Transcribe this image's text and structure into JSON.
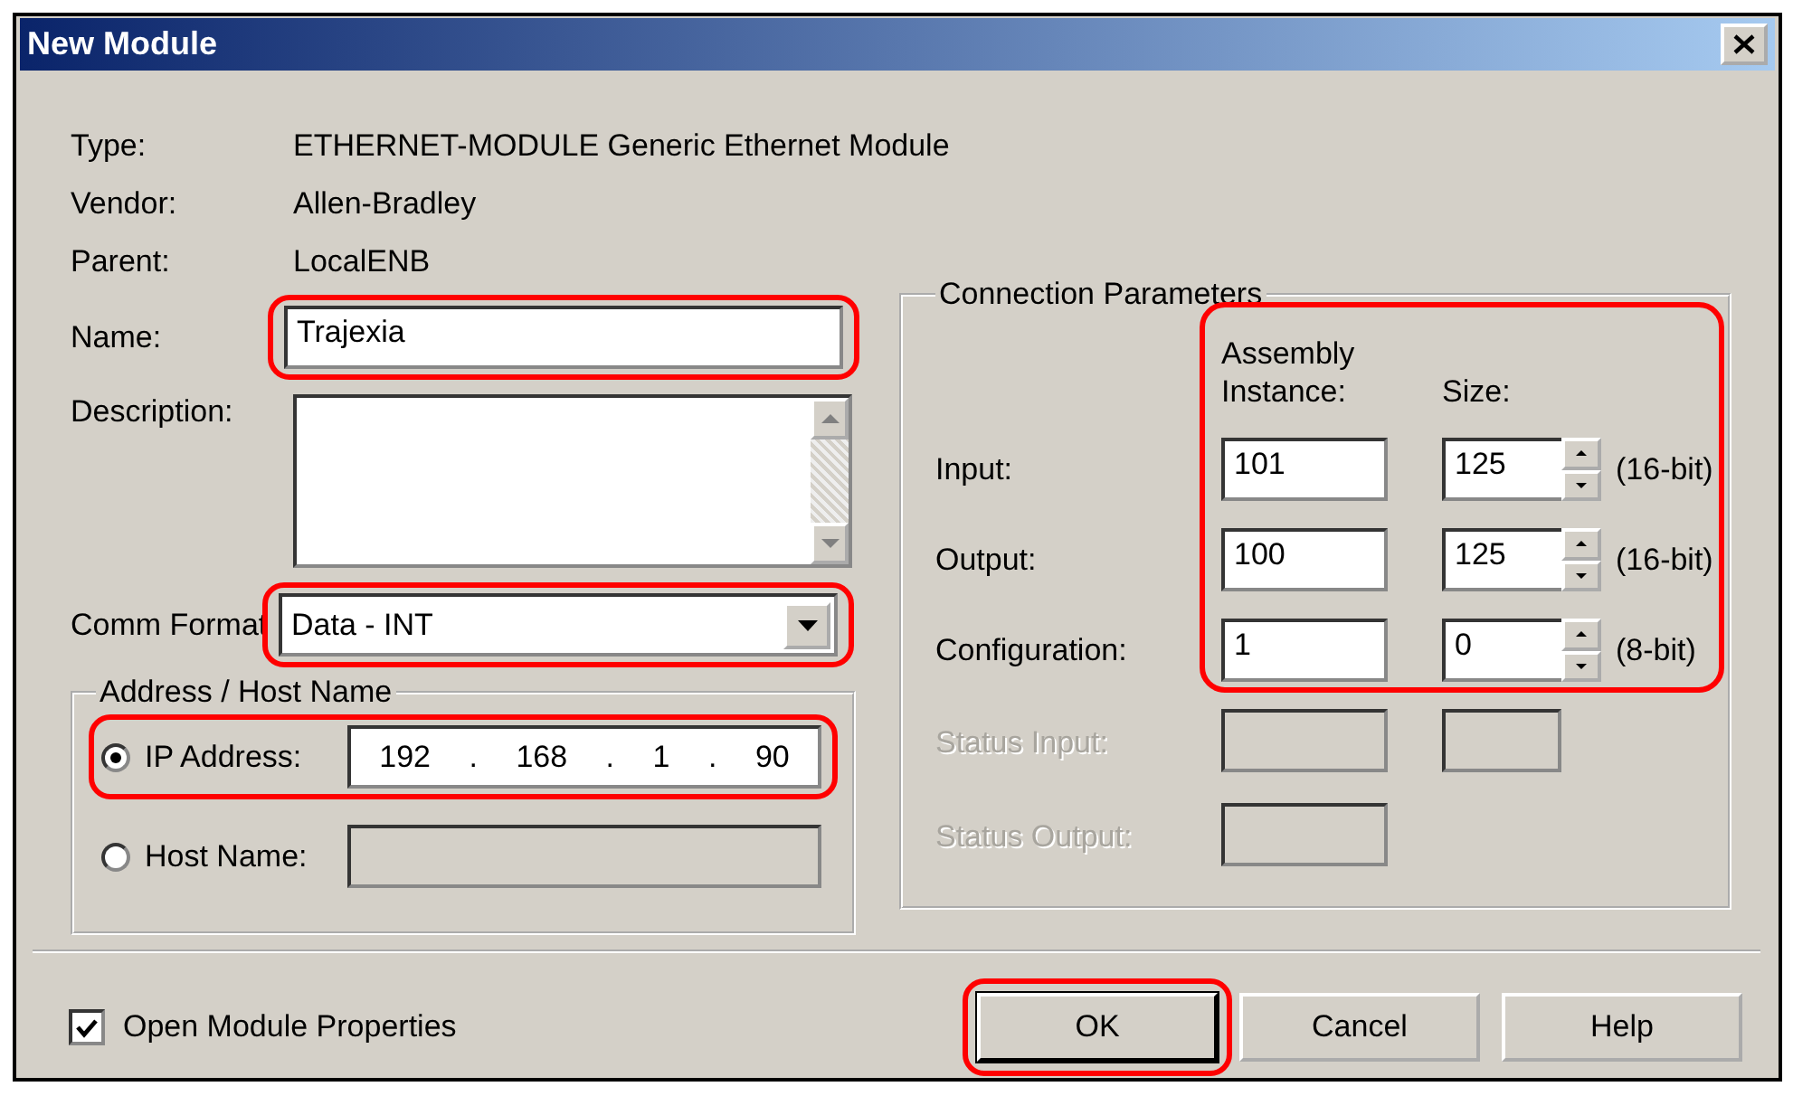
{
  "window": {
    "title": "New Module"
  },
  "info": [
    {
      "label": "Type:",
      "value": "ETHERNET-MODULE Generic Ethernet Module"
    },
    {
      "label": "Vendor:",
      "value": "Allen-Bradley"
    },
    {
      "label": "Parent:",
      "value": "LocalENB"
    }
  ],
  "name": {
    "label": "Name:",
    "value": "Trajexia",
    "highlighted": true
  },
  "description": {
    "label": "Description:"
  },
  "comm_format": {
    "label": "Comm Format",
    "value": "Data - INT",
    "highlighted": true
  },
  "address": {
    "title": "Address / Host Name",
    "options": [
      {
        "label": "IP Address:",
        "kind": "ip",
        "selected": true,
        "highlighted": true,
        "octets": [
          "192",
          "168",
          "1",
          "90"
        ],
        "separator": "."
      },
      {
        "label": "Host Name:",
        "kind": "text",
        "selected": false,
        "highlighted": false
      }
    ]
  },
  "connection": {
    "title": "Connection Parameters",
    "highlighted": true,
    "instance_header": "Assembly Instance:",
    "size_header": "Size:",
    "rows": [
      {
        "kind": "param",
        "label": "Input:",
        "instance": "101",
        "size": "125",
        "bits": "(16-bit)",
        "disabled": false
      },
      {
        "kind": "param",
        "label": "Output:",
        "instance": "100",
        "size": "125",
        "bits": "(16-bit)",
        "disabled": false
      },
      {
        "kind": "param",
        "label": "Configuration:",
        "instance": "1",
        "size": "0",
        "bits": "(8-bit)",
        "disabled": false
      },
      {
        "kind": "status",
        "label": "Status Input:",
        "size_box": true,
        "disabled": true
      },
      {
        "kind": "status",
        "label": "Status Output:",
        "size_box": false,
        "disabled": true
      }
    ]
  },
  "open_properties": {
    "label": "Open Module Properties",
    "checked": true
  },
  "buttons": [
    {
      "label": "OK",
      "default": true,
      "highlighted": true
    },
    {
      "label": "Cancel",
      "default": false,
      "highlighted": false
    },
    {
      "label": "Help",
      "default": false,
      "highlighted": false
    }
  ]
}
